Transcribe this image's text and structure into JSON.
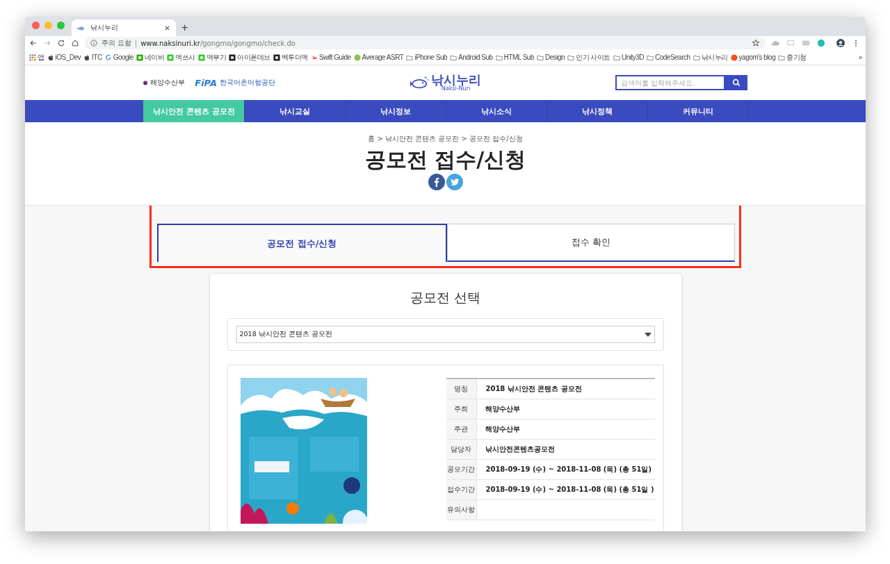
{
  "browser": {
    "tab_title": "낚시누리",
    "new_tab": "+",
    "security": "주의 요함",
    "url_host": "www.naksinuri.kr",
    "url_path": "/gongmo/gongmo/check.do",
    "bookmarks": [
      {
        "kind": "apps",
        "label": "앱"
      },
      {
        "kind": "apple",
        "label": "iOS_Dev"
      },
      {
        "kind": "apple",
        "label": "ITC"
      },
      {
        "kind": "google",
        "label": "Google"
      },
      {
        "kind": "naver",
        "label": "네이버"
      },
      {
        "kind": "green",
        "label": "맥쓰사"
      },
      {
        "kind": "green",
        "label": "맥부기"
      },
      {
        "kind": "dark",
        "label": "아이폰데브"
      },
      {
        "kind": "dark",
        "label": "벡투더맥"
      },
      {
        "kind": "swift",
        "label": "Swift Guide"
      },
      {
        "kind": "leaf",
        "label": "Average ASRT"
      },
      {
        "kind": "folder",
        "label": "iPhone Sub"
      },
      {
        "kind": "folder",
        "label": "Android Sub"
      },
      {
        "kind": "folder",
        "label": "HTML Sub"
      },
      {
        "kind": "folder",
        "label": "Design"
      },
      {
        "kind": "folder",
        "label": "인기 사이트"
      },
      {
        "kind": "folder",
        "label": "Unity3D"
      },
      {
        "kind": "folder",
        "label": "CodeSearch"
      },
      {
        "kind": "folder",
        "label": "낚시누리"
      },
      {
        "kind": "orange",
        "label": "yagom's blog"
      },
      {
        "kind": "folder",
        "label": "중기청"
      }
    ],
    "more": "»"
  },
  "header": {
    "ministry": "해양수산부",
    "agency_mark": "FiPA",
    "agency": "한국어촌어항공단",
    "logo": "낚시누리",
    "logo_sub": "Naksi-Nuri",
    "search": {
      "placeholder": "검색어를 입력해주세요."
    }
  },
  "nav": [
    {
      "label": "낚시안전 콘텐츠 공모전",
      "selected": true
    },
    {
      "label": "낚시교실",
      "selected": false
    },
    {
      "label": "낚시정보",
      "selected": false
    },
    {
      "label": "낚시소식",
      "selected": false
    },
    {
      "label": "낚시정책",
      "selected": false
    },
    {
      "label": "커뮤니티",
      "selected": false
    }
  ],
  "breadcrumb": "홈 > 낚시안전 콘텐츠 공모전 > 공모전 접수/신청",
  "title": "공모전 접수/신청",
  "tabs": [
    {
      "label": "공모전 접수/신청",
      "selected": true
    },
    {
      "label": "접수 확인",
      "selected": false
    }
  ],
  "section_title": "공모전 선택",
  "contest_select": {
    "value": "2018 낚시안전 콘텐츠 공모전"
  },
  "details": [
    {
      "label": "명칭",
      "value": "2018 낚시안전 콘텐츠 공모전"
    },
    {
      "label": "주최",
      "value": "해양수산부"
    },
    {
      "label": "주관",
      "value": "해양수산부"
    },
    {
      "label": "담당자",
      "value": "낚시안전콘텐츠공모전"
    },
    {
      "label": "공모기간",
      "value": "2018-09-19 (수) ~ 2018-11-08 (목) (총 51일)"
    },
    {
      "label": "접수기간",
      "value": "2018-09-19 (수) ~ 2018-11-08 (목) (총 51일 )"
    },
    {
      "label": "유의사항"
    }
  ]
}
